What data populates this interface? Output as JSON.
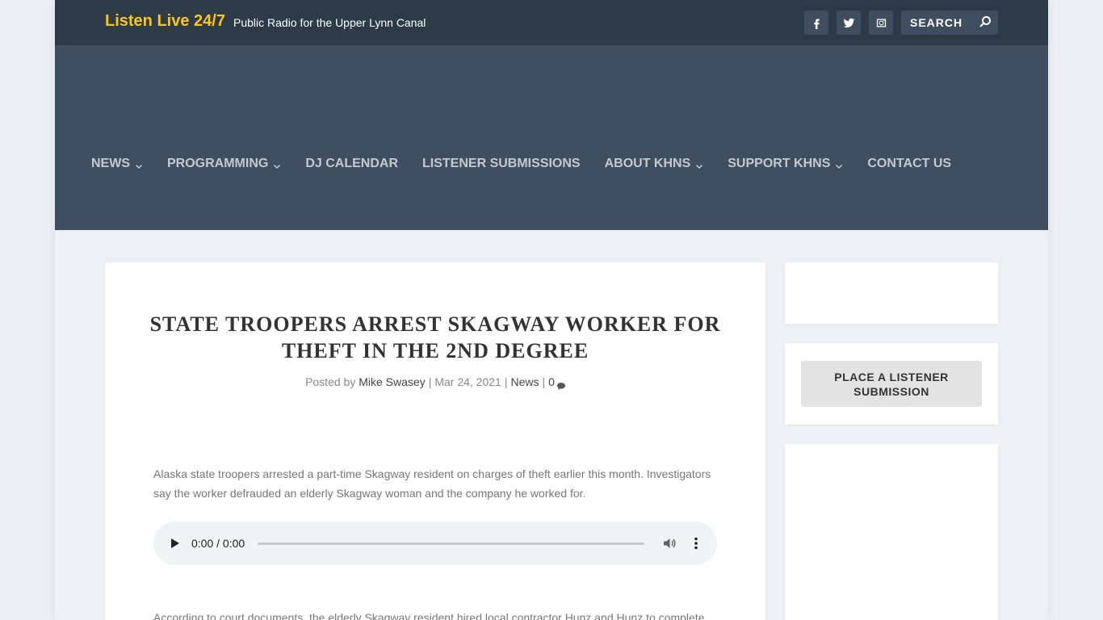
{
  "topbar": {
    "listen_live": "Listen Live 24/7",
    "tagline": "Public Radio for the Upper Lynn Canal",
    "social": [
      {
        "icon": "facebook-icon"
      },
      {
        "icon": "twitter-icon"
      },
      {
        "icon": "instagram-icon"
      }
    ],
    "search": {
      "placeholder": "SEARCH",
      "icon": "search-icon"
    }
  },
  "nav": {
    "items": [
      {
        "label": "NEWS",
        "has_dropdown": true
      },
      {
        "label": "PROGRAMMING",
        "has_dropdown": true
      },
      {
        "label": "DJ CALENDAR",
        "has_dropdown": false
      },
      {
        "label": "LISTENER SUBMISSIONS",
        "has_dropdown": false
      },
      {
        "label": "ABOUT KHNS",
        "has_dropdown": true
      },
      {
        "label": "SUPPORT KHNS",
        "has_dropdown": true
      },
      {
        "label": "CONTACT US",
        "has_dropdown": false
      }
    ]
  },
  "post": {
    "title": "STATE TROOPERS ARREST SKAGWAY WORKER FOR THEFT IN THE 2ND DEGREE",
    "meta": {
      "posted_by": "Posted by",
      "author": "Mike Swasey",
      "date": "Mar 24, 2021",
      "category": "News",
      "comments": "0"
    },
    "paragraph1": "Alaska state troopers arrested a part-time Skagway resident on charges of theft earlier this month.  Investigators say the worker defrauded an elderly Skagway woman and the company he worked for.",
    "audio": {
      "time": "0:00 / 0:00",
      "progress": 0
    },
    "paragraph2": "According to court documents, the elderly Skagway resident hired local contractor Hunz and Hunz to complete"
  },
  "sidebar": {
    "submit_button": "PLACE A LISTENER SUBMISSION"
  },
  "colors": {
    "topbar_bg": "#2d3a48",
    "header_bg": "#3f4f60",
    "accent_yellow": "#f7c71b",
    "nav_text": "#c2c9d1"
  }
}
